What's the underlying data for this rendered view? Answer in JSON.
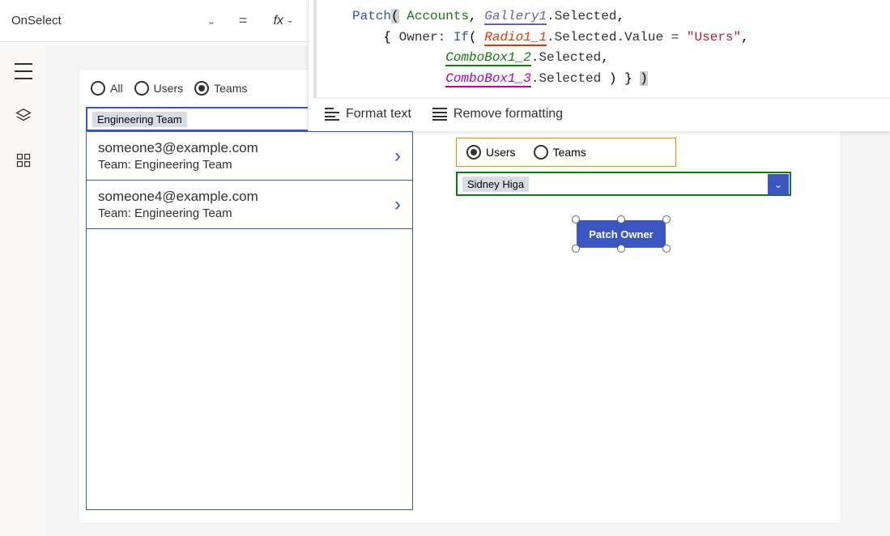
{
  "property_dropdown": {
    "label": "OnSelect"
  },
  "fx": {
    "label": "fx"
  },
  "formula": {
    "fn_patch": "Patch",
    "ds_accounts": "Accounts",
    "gal": "Gallery1",
    "selected": ".Selected",
    "owner": "Owner:",
    "if": "If",
    "radio": "Radio1_1",
    "selval": ".Selected.Value",
    "eq": "=",
    "users_str": "\"Users\"",
    "cb2": "ComboBox1_2",
    "cb3": "ComboBox1_3",
    "selsuffix": ".Selected"
  },
  "actions": {
    "format": "Format text",
    "remove": "Remove formatting"
  },
  "left_radio": {
    "all": "All",
    "users": "Users",
    "teams": "Teams"
  },
  "combo_left_val": "Engineering Team",
  "gallery": [
    {
      "email": "someone3@example.com",
      "team": "Team: Engineering Team"
    },
    {
      "email": "someone4@example.com",
      "team": "Team: Engineering Team"
    }
  ],
  "right_radio": {
    "users": "Users",
    "teams": "Teams"
  },
  "combo_right_val": "Sidney Higa",
  "patch_button": "Patch Owner"
}
